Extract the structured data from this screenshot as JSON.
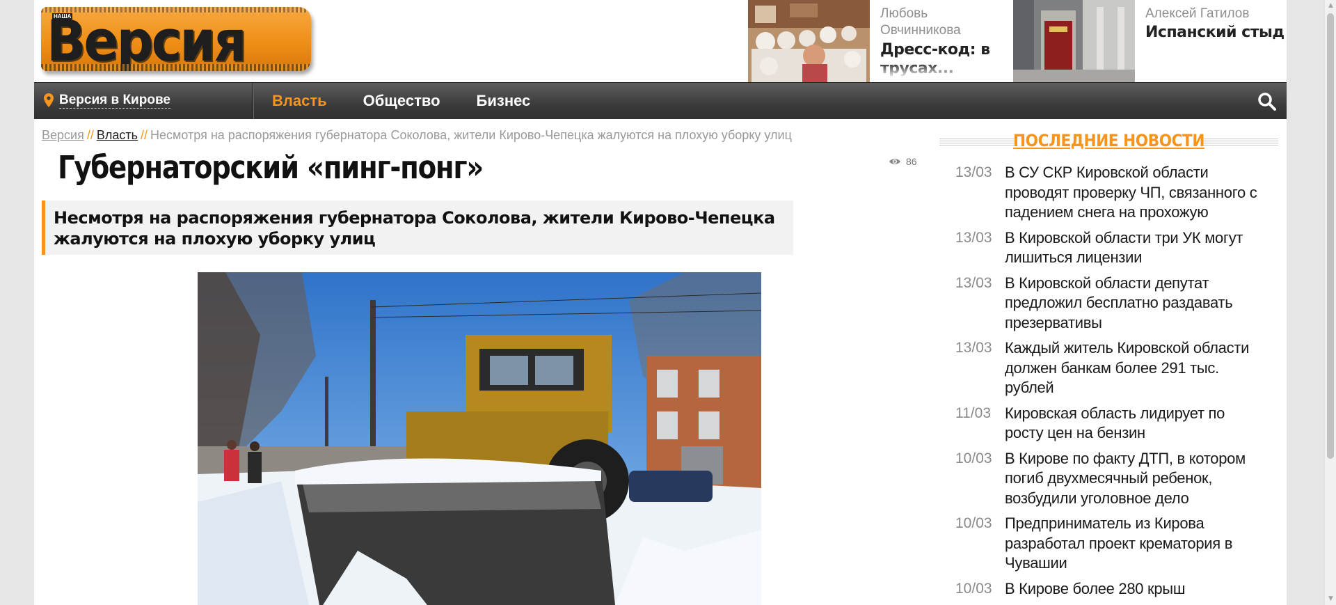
{
  "logo": {
    "text": "Версия",
    "small_text": "НАША"
  },
  "promos": [
    {
      "author": "Любовь Овчинникова",
      "title": "Дресс-код: в трусах..."
    },
    {
      "author": "Алексей Гатилов",
      "title": "Испанский стыд"
    }
  ],
  "nav": {
    "city": "Версия в Кирове",
    "menu": [
      "Власть",
      "Общество",
      "Бизнес"
    ]
  },
  "breadcrumb": {
    "home": "Версия",
    "section": "Власть",
    "current": "Несмотря на распоряжения губернатора Соколова, жители Кирово-Чепецка жалуются на плохую уборку улиц"
  },
  "article": {
    "title": "Губернаторский «пинг-понг»",
    "views": "86",
    "lead": "Несмотря на распоряжения губернатора Соколова, жители Кирово-Чепецка жалуются на плохую уборку улиц"
  },
  "sidebar": {
    "heading": "ПОСЛЕДНИЕ НОВОСТИ",
    "news": [
      {
        "date": "13/03",
        "text": "В СУ СКР Кировской области проводят проверку ЧП, связанного с падением снега на прохожую"
      },
      {
        "date": "13/03",
        "text": "В Кировской области три УК могут лишиться лицензии"
      },
      {
        "date": "13/03",
        "text": "В Кировской области депутат предложил бесплатно раздавать презервативы"
      },
      {
        "date": "13/03",
        "text": "Каждый житель Кировской области должен банкам более 291 тыс. рублей"
      },
      {
        "date": "11/03",
        "text": "Кировская область лидирует по росту цен на бензин"
      },
      {
        "date": "10/03",
        "text": "В Кирове по факту ДТП, в котором погиб двухмесячный ребенок, возбудили уголовное дело"
      },
      {
        "date": "10/03",
        "text": "Предприниматель из Кирова разработал проект крематория в Чувашии"
      },
      {
        "date": "10/03",
        "text": "В Кирове более 280 крыш"
      }
    ]
  },
  "colors": {
    "accent": "#f7941d",
    "nav_bg": "#3b3b3b"
  }
}
